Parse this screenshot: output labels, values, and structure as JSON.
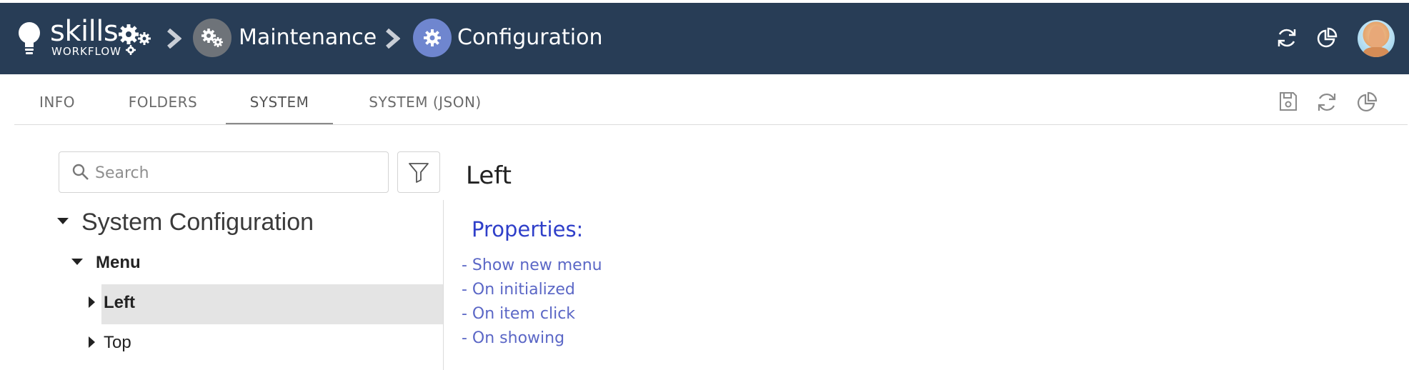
{
  "header": {
    "logo_text": "skills",
    "logo_sub": "WORKFLOW",
    "breadcrumb": [
      {
        "label": "Maintenance",
        "icon": "gears-icon",
        "color": "#6e7379"
      },
      {
        "label": "Configuration",
        "icon": "gear-icon",
        "color": "#6f86cf"
      }
    ],
    "actions": [
      "refresh-icon",
      "pie-chart-icon",
      "avatar"
    ],
    "background": "#283d56"
  },
  "tabs": [
    {
      "label": "INFO",
      "active": false
    },
    {
      "label": "FOLDERS",
      "active": false
    },
    {
      "label": "SYSTEM",
      "active": true
    },
    {
      "label": "SYSTEM (JSON)",
      "active": false
    }
  ],
  "toolbar": [
    "save-icon",
    "refresh-icon",
    "pie-chart-icon"
  ],
  "search": {
    "placeholder": "Search",
    "value": ""
  },
  "tree": {
    "root": "System Configuration",
    "child": "Menu",
    "items": [
      {
        "label": "Left",
        "selected": true
      },
      {
        "label": "Top",
        "selected": false
      }
    ]
  },
  "detail": {
    "title": "Left",
    "properties_heading": "Properties:",
    "properties": [
      "- Show new menu",
      "- On initialized",
      "- On item click",
      "- On showing"
    ]
  }
}
